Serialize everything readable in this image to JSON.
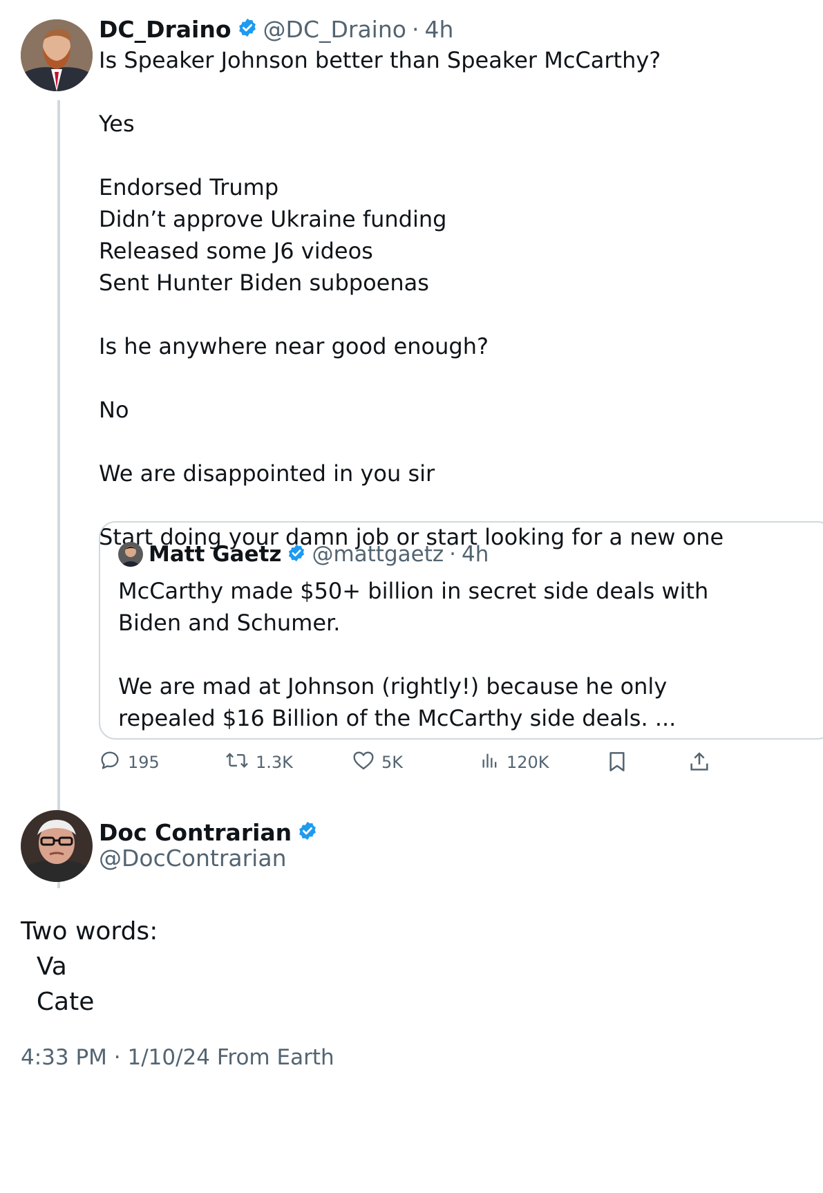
{
  "main_tweet": {
    "display_name": "DC_Draino",
    "handle": "@DC_Draino",
    "time": "4h",
    "text": "Is Speaker Johnson better than Speaker McCarthy?\n\nYes\n\nEndorsed Trump\nDidn’t approve Ukraine funding\nReleased some J6 videos\nSent Hunter Biden subpoenas\n\nIs he anywhere near good enough?\n\nNo\n\nWe are disappointed in you sir\n\nStart doing your damn job or start looking for a new one"
  },
  "quoted_tweet": {
    "display_name": "Matt Gaetz",
    "handle": "@mattgaetz",
    "time": "4h",
    "text": "McCarthy made $50+ billion in secret side deals with Biden and Schumer.\n\nWe are mad at Johnson (rightly!) because he only repealed $16 Billion of the McCarthy side deals. ..."
  },
  "actions": {
    "replies": "195",
    "retweets": "1.3K",
    "likes": "5K",
    "views": "120K"
  },
  "reply_tweet": {
    "display_name": "Doc Contrarian",
    "handle": "@DocContrarian",
    "text": "Two words:\n  Va\n  Cate",
    "timestamp": "4:33 PM · 1/10/24 From Earth"
  },
  "colors": {
    "verified": "#1d9bf0",
    "secondary_text": "#536471",
    "border": "#cfd9de"
  }
}
